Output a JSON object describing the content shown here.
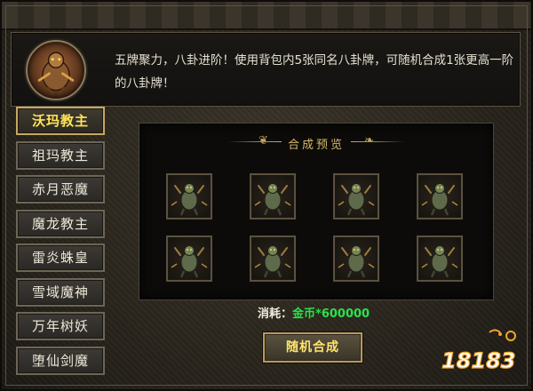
{
  "description": "五牌聚力，八卦进阶！使用背包内5张同名八卦牌，可随机合成1张更高一阶的八卦牌！",
  "sidebar": {
    "items": [
      {
        "label": "沃玛教主",
        "active": true
      },
      {
        "label": "祖玛教主",
        "active": false
      },
      {
        "label": "赤月恶魔",
        "active": false
      },
      {
        "label": "魔龙教主",
        "active": false
      },
      {
        "label": "雷炎蛛皇",
        "active": false
      },
      {
        "label": "雪域魔神",
        "active": false
      },
      {
        "label": "万年树妖",
        "active": false
      },
      {
        "label": "堕仙剑魔",
        "active": false
      }
    ]
  },
  "preview": {
    "title": "合成预览",
    "cards": [
      {
        "icon": "bagua-card-icon"
      },
      {
        "icon": "bagua-card-icon"
      },
      {
        "icon": "bagua-card-icon"
      },
      {
        "icon": "bagua-card-icon"
      },
      {
        "icon": "bagua-card-icon"
      },
      {
        "icon": "bagua-card-icon"
      },
      {
        "icon": "bagua-card-icon"
      },
      {
        "icon": "bagua-card-icon"
      }
    ]
  },
  "cost": {
    "label": "消耗：",
    "value": "金币*600000"
  },
  "button": {
    "label": "随机合成"
  },
  "watermark": {
    "text": "18183"
  },
  "colors": {
    "accent_gold": "#ffe35a",
    "cost_green": "#28e24a",
    "watermark_orange": "#f2a62a"
  }
}
